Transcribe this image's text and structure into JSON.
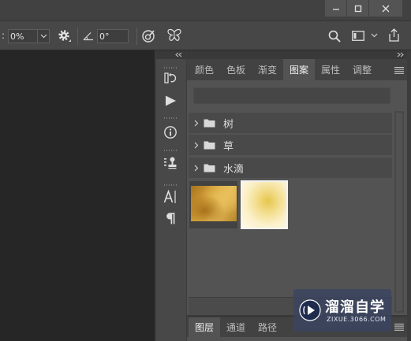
{
  "title_bar": {
    "controls": [
      "minimize-icon",
      "maximize-icon",
      "close-icon"
    ]
  },
  "options_bar": {
    "flow_label": ":",
    "flow_value": "0%",
    "angle_value": "0°",
    "icons": [
      "chevron-down-icon",
      "gear-icon",
      "angle-icon",
      "airbrush-icon",
      "symmetry-icon",
      "search-icon",
      "workspace-icon",
      "share-icon"
    ]
  },
  "icon_strip": {
    "icons": [
      "expand-panels-icon",
      "history-icon",
      "actions-icon",
      "info-icon",
      "clone-source-icon",
      "character-icon",
      "paragraph-icon"
    ]
  },
  "patterns_panel": {
    "tabs": [
      {
        "label": "颜色",
        "active": false
      },
      {
        "label": "色板",
        "active": false
      },
      {
        "label": "渐变",
        "active": false
      },
      {
        "label": "图案",
        "active": true
      },
      {
        "label": "属性",
        "active": false
      },
      {
        "label": "调整",
        "active": false
      }
    ],
    "groups": [
      {
        "name": "树",
        "expanded": false
      },
      {
        "name": "草",
        "expanded": false
      },
      {
        "name": "水滴",
        "expanded": false
      }
    ],
    "patterns": [
      {
        "colors": [
          "#a8721c",
          "#d7a63d",
          "#e8bf5b",
          "#b5832a"
        ],
        "selected": false
      },
      {
        "colors": [
          "#e6c64c",
          "#f2dc8a",
          "#fbf0c8",
          "#fff9ea"
        ],
        "selected": true
      }
    ]
  },
  "layers_panel": {
    "tabs": [
      {
        "label": "图层",
        "active": true
      },
      {
        "label": "通道",
        "active": false
      },
      {
        "label": "路径",
        "active": false
      }
    ]
  },
  "watermark": {
    "title": "溜溜自学",
    "url": "ZIXUE.3066.COM"
  },
  "theme": {
    "canvas": "#262626",
    "panel": "#535353",
    "tab_bar": "#424242",
    "text": "#d2d2d2"
  }
}
